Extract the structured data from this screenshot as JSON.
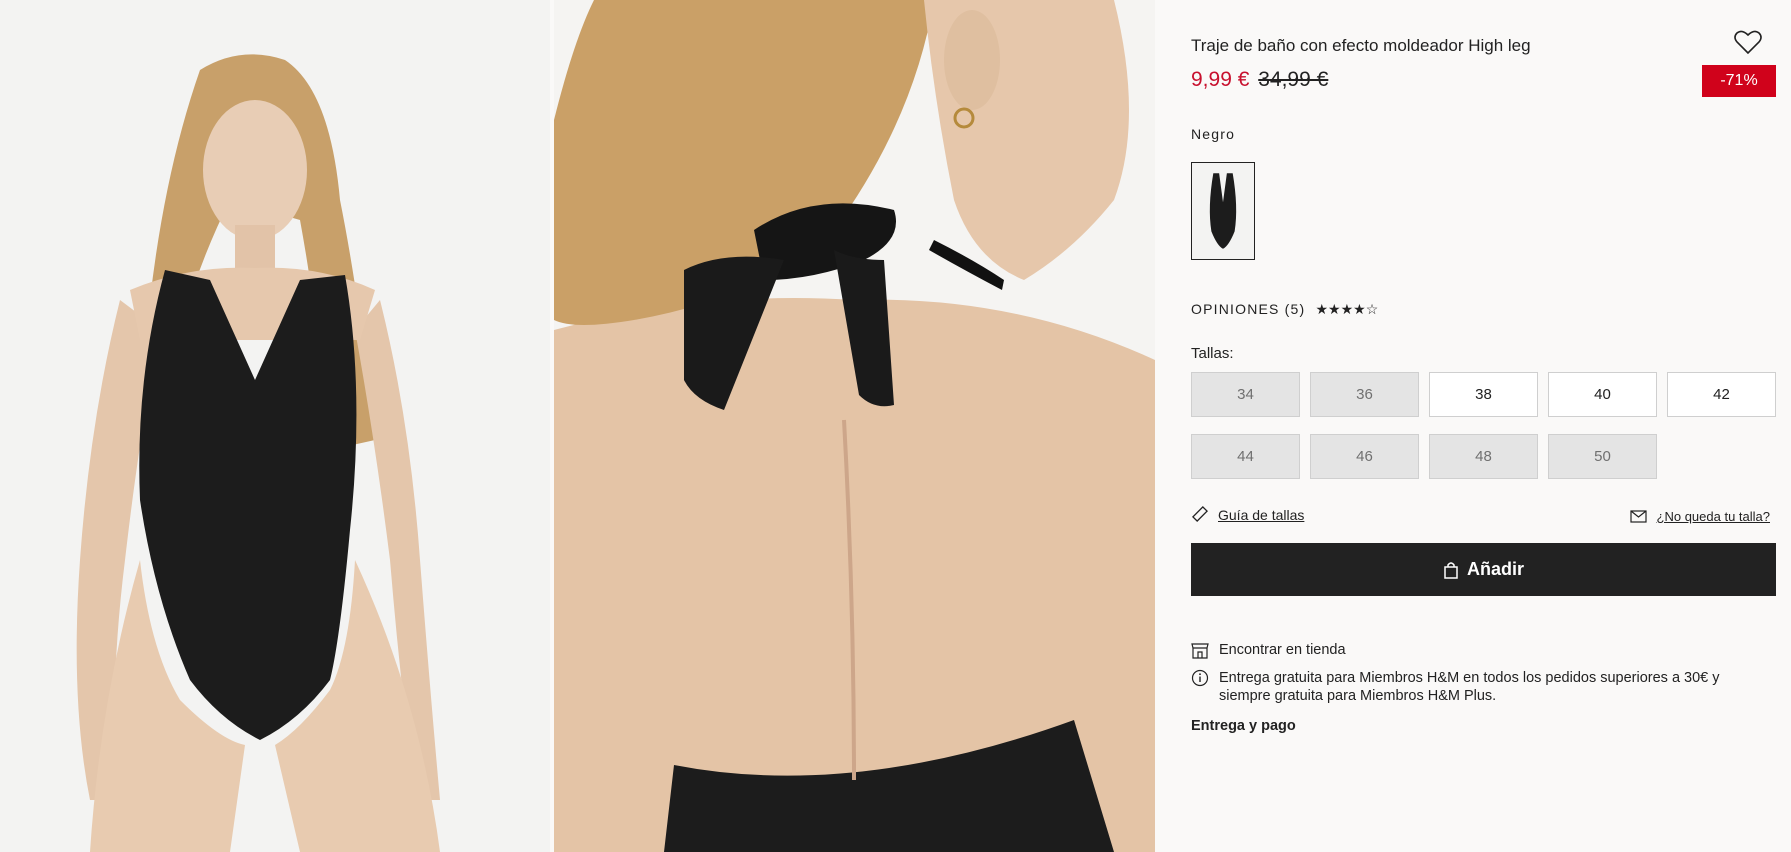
{
  "product": {
    "title": "Traje de baño con efecto moldeador High leg",
    "price_sale": "9,99 €",
    "price_original": "34,99 €",
    "discount_badge": "-71%",
    "color_name": "Negro"
  },
  "reviews": {
    "label": "OPINIONES (5)",
    "stars": "★★★★☆"
  },
  "sizes": {
    "label": "Tallas:",
    "items": [
      {
        "label": "34",
        "available": false
      },
      {
        "label": "36",
        "available": false
      },
      {
        "label": "38",
        "available": true
      },
      {
        "label": "40",
        "available": true
      },
      {
        "label": "42",
        "available": true
      },
      {
        "label": "44",
        "available": false
      },
      {
        "label": "46",
        "available": false
      },
      {
        "label": "48",
        "available": false
      },
      {
        "label": "50",
        "available": false
      }
    ]
  },
  "links": {
    "size_guide": "Guía de tallas",
    "size_missing": "¿No queda tu talla?"
  },
  "cta": {
    "add_label": "Añadir"
  },
  "info": {
    "find_in_store": "Encontrar en tienda",
    "free_delivery": "Entrega gratuita para Miembros H&M en todos los pedidos superiores a 30€ y siempre gratuita para Miembros H&M Plus.",
    "delivery_payment": "Entrega y pago"
  },
  "colors": {
    "sale_red": "#c8102e",
    "badge_red": "#d0021b",
    "button_dark": "#222222"
  }
}
